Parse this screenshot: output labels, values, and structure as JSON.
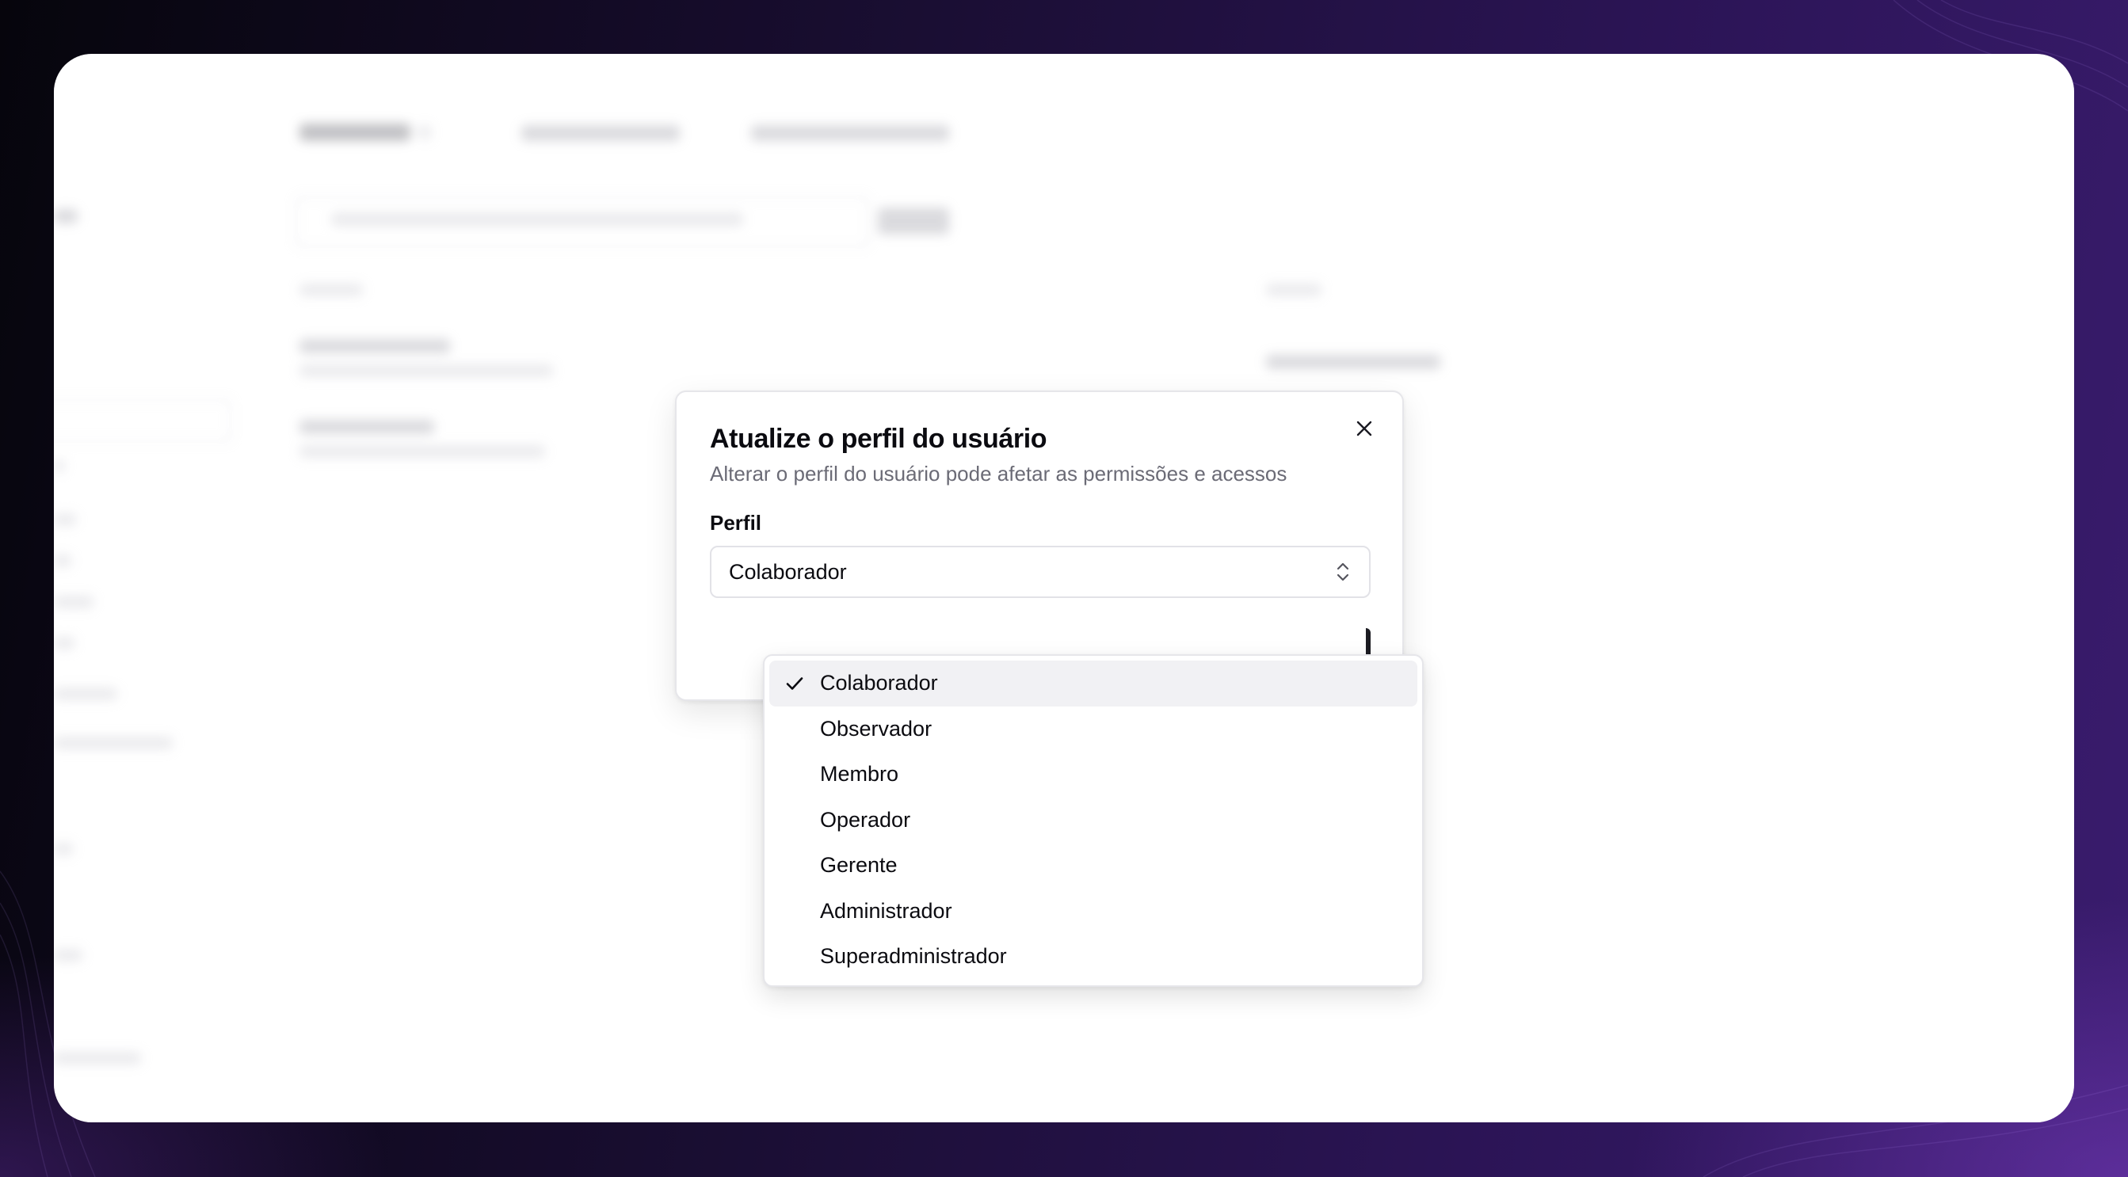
{
  "dialog": {
    "title": "Atualize o perfil do usuário",
    "description": "Alterar o perfil do usuário pode afetar as permissões e acessos",
    "field_label": "Perfil",
    "selected_value": "Colaborador"
  },
  "dropdown": {
    "options": [
      {
        "label": "Colaborador",
        "selected": true
      },
      {
        "label": "Observador",
        "selected": false
      },
      {
        "label": "Membro",
        "selected": false
      },
      {
        "label": "Operador",
        "selected": false
      },
      {
        "label": "Gerente",
        "selected": false
      },
      {
        "label": "Administrador",
        "selected": false
      },
      {
        "label": "Superadministrador",
        "selected": false
      }
    ]
  },
  "icons": {
    "close": "close-icon",
    "select_chevrons": "chevron-up-down-icon",
    "selected_check": "check-icon"
  },
  "colors": {
    "selected_option_bg": "#f1f1f4",
    "text_primary": "#0b0b10",
    "text_muted": "#6b6b76"
  }
}
